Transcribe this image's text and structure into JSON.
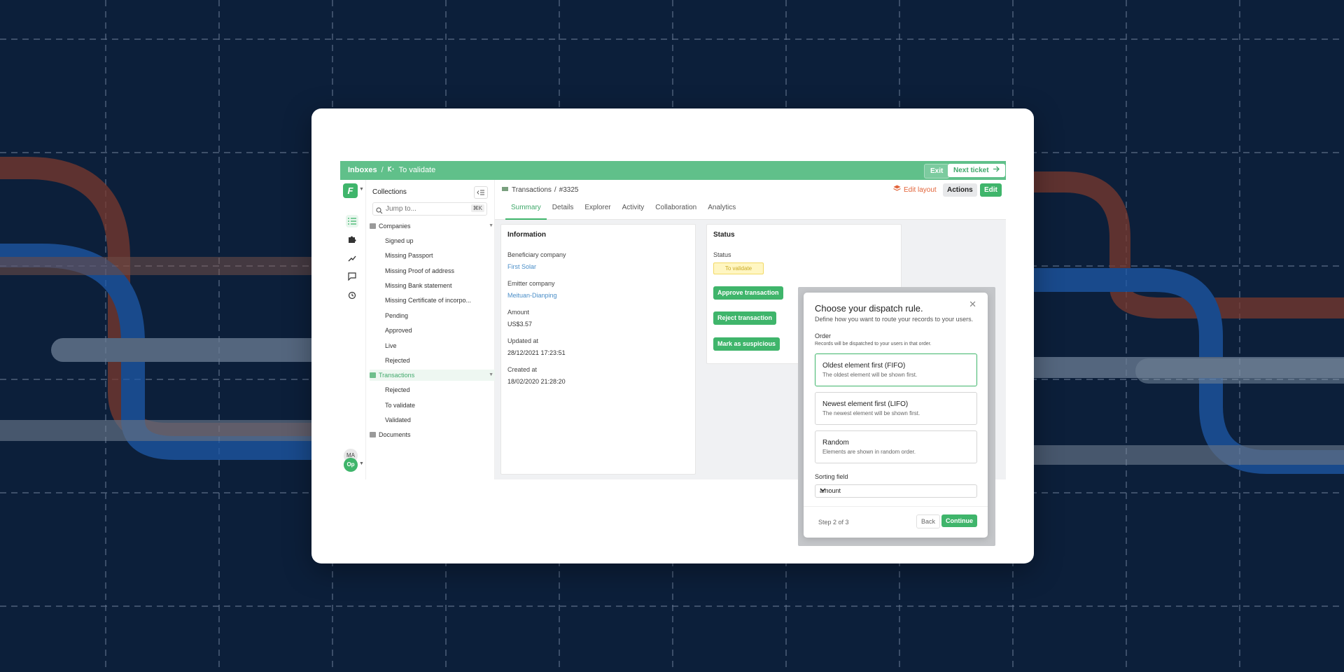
{
  "topbar": {
    "crumb1": "Inboxes",
    "sep": "/",
    "crumb2": "To validate",
    "exit": "Exit",
    "next": "Next ticket"
  },
  "sidebar": {
    "title": "Collections",
    "search_placeholder": "Jump to...",
    "shortcut": "⌘K",
    "companies": {
      "label": "Companies",
      "items": [
        "Signed up",
        "Missing Passport",
        "Missing Proof of address",
        "Missing Bank statement",
        "Missing Certificate of incorpo...",
        "Pending",
        "Approved",
        "Live",
        "Rejected"
      ]
    },
    "transactions": {
      "label": "Transactions",
      "items": [
        "Rejected",
        "To validate",
        "Validated"
      ]
    },
    "documents": {
      "label": "Documents"
    }
  },
  "user": {
    "initials1": "MA",
    "initials2": "Op"
  },
  "record": {
    "collection": "Transactions",
    "sep": "/",
    "id": "#3325"
  },
  "toolbar": {
    "edit_layout": "Edit layout",
    "actions": "Actions",
    "edit": "Edit"
  },
  "tabs": [
    "Summary",
    "Details",
    "Explorer",
    "Activity",
    "Collaboration",
    "Analytics"
  ],
  "info": {
    "title": "Information",
    "fields": [
      {
        "label": "Beneficiary company",
        "value": "First Solar"
      },
      {
        "label": "Emitter company",
        "value": "Meituan-Dianping"
      },
      {
        "label": "Amount",
        "value": "US$3.57"
      },
      {
        "label": "Updated at",
        "value": "28/12/2021 17:23:51"
      },
      {
        "label": "Created at",
        "value": "18/02/2020 21:28:20"
      }
    ]
  },
  "status": {
    "title": "Status",
    "label": "Status",
    "badge": "To validate",
    "approve": "Approve transaction",
    "reject": "Reject transaction",
    "suspicious": "Mark as suspicious"
  },
  "modal": {
    "title": "Choose your dispatch rule.",
    "subtitle": "Define how you want to route your records to your users.",
    "order_label": "Order",
    "order_sub": "Records will be dispatched to your users in that order.",
    "options": [
      {
        "title": "Oldest element first (FIFO)",
        "desc": "The oldest element will be shown first."
      },
      {
        "title": "Newest element first (LIFO)",
        "desc": "The newest element will be shown first."
      },
      {
        "title": "Random",
        "desc": "Elements are shown in random order."
      }
    ],
    "sort_label": "Sorting field",
    "sort_value": "amount",
    "step": "Step 2 of 3",
    "back": "Back",
    "continue": "Continue"
  },
  "colors": {
    "brand": "#3fb56b",
    "topbar": "#60c08a",
    "background": "#0c1f3a",
    "link": "#4a8ec8",
    "edit_layout": "#e2643a"
  },
  "icons": [
    "arrow-right-icon",
    "search-icon",
    "collapse-icon",
    "list-icon",
    "puzzle-icon",
    "trend-icon",
    "chat-icon",
    "history-icon",
    "layers-icon",
    "chevron-down-icon",
    "close-icon"
  ]
}
